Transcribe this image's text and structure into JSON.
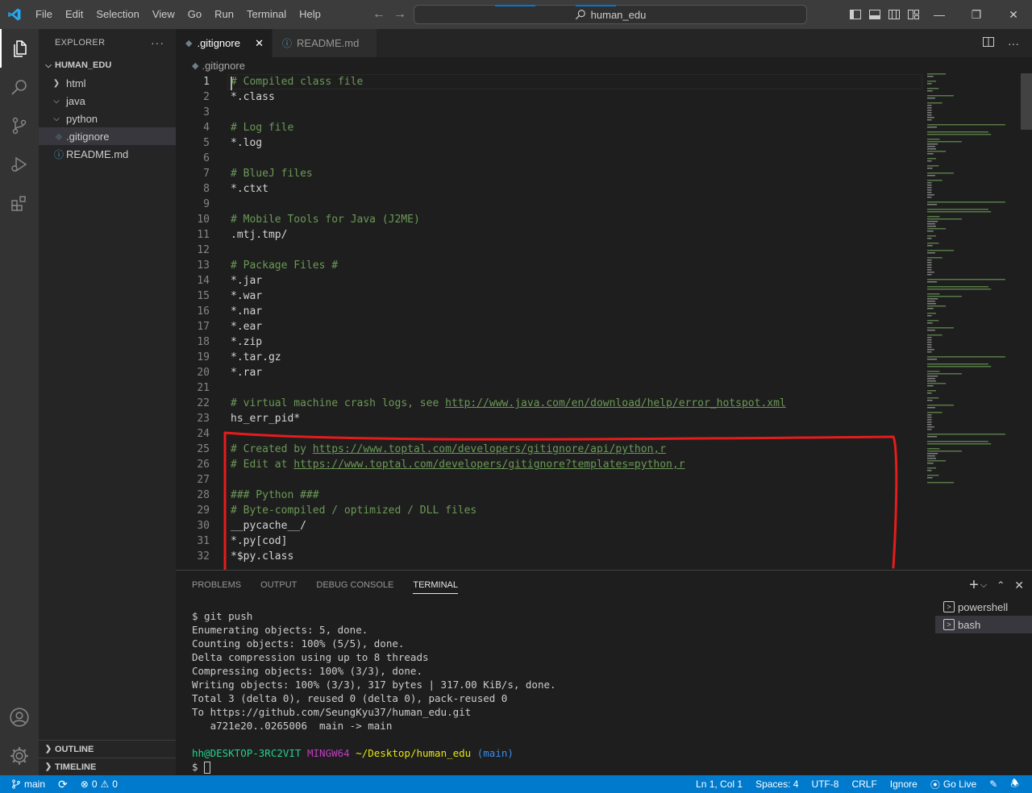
{
  "titlebar": {
    "menus": [
      "File",
      "Edit",
      "Selection",
      "View",
      "Go",
      "Run",
      "Terminal",
      "Help"
    ],
    "search_text": "human_edu"
  },
  "sidebar": {
    "header": "EXPLORER",
    "root": "HUMAN_EDU",
    "items": [
      {
        "label": "html",
        "type": "folder"
      },
      {
        "label": "java",
        "type": "folder"
      },
      {
        "label": "python",
        "type": "folder"
      },
      {
        "label": ".gitignore",
        "type": "file"
      },
      {
        "label": "README.md",
        "type": "file"
      }
    ],
    "outline_label": "OUTLINE",
    "timeline_label": "TIMELINE"
  },
  "tabs": [
    {
      "label": ".gitignore",
      "active": true
    },
    {
      "label": "README.md",
      "active": false
    }
  ],
  "breadcrumb": ".gitignore",
  "code_lines": [
    "# Compiled class file",
    "*.class",
    "",
    "# Log file",
    "*.log",
    "",
    "# BlueJ files",
    "*.ctxt",
    "",
    "# Mobile Tools for Java (J2ME)",
    ".mtj.tmp/",
    "",
    "# Package Files #",
    "*.jar",
    "*.war",
    "*.nar",
    "*.ear",
    "*.zip",
    "*.tar.gz",
    "*.rar",
    "",
    "# virtual machine crash logs, see http://www.java.com/en/download/help/error_hotspot.xml",
    "hs_err_pid*",
    "",
    "# Created by https://www.toptal.com/developers/gitignore/api/python,r",
    "# Edit at https://www.toptal.com/developers/gitignore?templates=python,r",
    "",
    "### Python ###",
    "# Byte-compiled / optimized / DLL files",
    "__pycache__/",
    "*.py[cod]",
    "*$py.class"
  ],
  "panel": {
    "tabs": [
      "PROBLEMS",
      "OUTPUT",
      "DEBUG CONSOLE",
      "TERMINAL"
    ],
    "active_tab": "TERMINAL",
    "terminal_lines": [
      "$ git push",
      "Enumerating objects: 5, done.",
      "Counting objects: 100% (5/5), done.",
      "Delta compression using up to 8 threads",
      "Compressing objects: 100% (3/3), done.",
      "Writing objects: 100% (3/3), 317 bytes | 317.00 KiB/s, done.",
      "Total 3 (delta 0), reused 0 (delta 0), pack-reused 0",
      "To https://github.com/SeungKyu37/human_edu.git",
      "   a721e20..0265006  main -> main"
    ],
    "prompt": {
      "user_host": "hh@DESKTOP-3RC2VIT",
      "shell": "MINGW64",
      "path": "~/Desktop/human_edu",
      "branch": "(main)",
      "symbol": "$"
    },
    "terminals": [
      "powershell",
      "bash"
    ]
  },
  "statusbar": {
    "branch": "main",
    "errors": "0",
    "warnings": "0",
    "position": "Ln 1, Col 1",
    "spaces": "Spaces: 4",
    "encoding": "UTF-8",
    "eol": "CRLF",
    "language": "Ignore",
    "live": "Go Live"
  },
  "colors": {
    "accent": "#007acc",
    "comment": "#6a9955",
    "annotation": "#e51c1c"
  }
}
